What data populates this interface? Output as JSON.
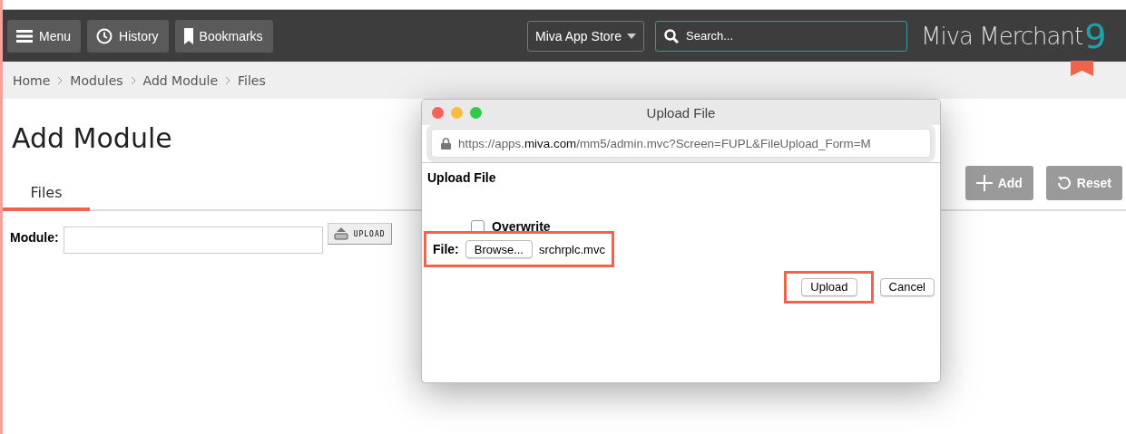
{
  "toolbar": {
    "buttons": [
      {
        "kind": "menu",
        "label": "Menu"
      },
      {
        "kind": "history",
        "label": "History"
      },
      {
        "kind": "bookmarks",
        "label": "Bookmarks"
      }
    ],
    "store_dropdown": "Miva App Store",
    "search": {
      "placeholder": "Search..."
    },
    "logo": {
      "text": "Miva Merchant",
      "mark": "9"
    }
  },
  "breadcrumb": [
    "Home",
    "Modules",
    "Add Module",
    "Files"
  ],
  "page_title": "Add Module",
  "tabs": [
    {
      "label": "Files",
      "selected": true
    }
  ],
  "actions": [
    {
      "kind": "add",
      "label": "Add"
    },
    {
      "kind": "reset",
      "label": "Reset"
    }
  ],
  "module_form": {
    "label": "Module:",
    "button": "UPLOAD"
  },
  "dialog": {
    "title": "Upload File",
    "url": {
      "prefix": "https://apps.",
      "domain": "miva.com",
      "rest": "/mm5/admin.mvc?Screen=FUPL&FileUpload_Form=M"
    },
    "heading": "Upload File",
    "overwrite": {
      "label": "Overwrite",
      "checked": false
    },
    "file": {
      "label": "File:",
      "button": "Browse...",
      "value": "srchrplc.mvc",
      "highlighted": true
    },
    "buttons": [
      {
        "label": "Upload",
        "highlighted": true
      },
      {
        "label": "Cancel",
        "highlighted": false
      }
    ]
  }
}
